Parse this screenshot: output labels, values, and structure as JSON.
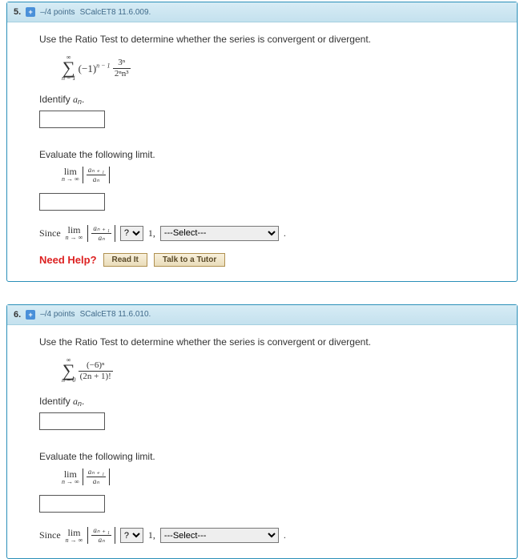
{
  "questions": [
    {
      "number": "5.",
      "icon": "+",
      "points": "–/4 points",
      "ref": "SCalcET8 11.6.009.",
      "instruction": "Use the Ratio Test to determine whether the series is convergent or divergent.",
      "sum_lower": "n = 1",
      "sum_upper": "∞",
      "term_plain": "(−1)",
      "term_exp": "n − 1",
      "frac_num": "3ⁿ",
      "frac_den": "2ⁿn³",
      "identify_label_pre": "Identify ",
      "identify_var": "a",
      "identify_sub": "n",
      "identify_label_post": ".",
      "evaluate_label": "Evaluate the following limit.",
      "lim_text": "lim",
      "lim_sub": "n → ∞",
      "ratio_num": "aₙ ₊ ₁",
      "ratio_den": "aₙ",
      "since_label": "Since   ",
      "comp_placeholder": "?",
      "one_label": " 1, ",
      "select_placeholder": "---Select---",
      "period": " .",
      "need_help": "Need Help?",
      "read_it": "Read It",
      "tutor": "Talk to a Tutor"
    },
    {
      "number": "6.",
      "icon": "+",
      "points": "–/4 points",
      "ref": "SCalcET8 11.6.010.",
      "instruction": "Use the Ratio Test to determine whether the series is convergent or divergent.",
      "sum_lower": "n = 0",
      "sum_upper": "∞",
      "frac_num": "(−6)ⁿ",
      "frac_den": "(2n + 1)!",
      "identify_label_pre": "Identify ",
      "identify_var": "a",
      "identify_sub": "n",
      "identify_label_post": ".",
      "evaluate_label": "Evaluate the following limit.",
      "lim_text": "lim",
      "lim_sub": "n → ∞",
      "ratio_num": "aₙ ₊ ₁",
      "ratio_den": "aₙ",
      "since_label": "Since   ",
      "comp_placeholder": "?",
      "one_label": " 1, ",
      "select_placeholder": "---Select---",
      "period": " ."
    }
  ]
}
